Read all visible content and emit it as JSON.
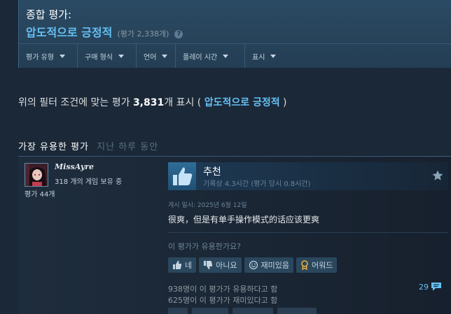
{
  "summary": {
    "label": "종합 평가:",
    "value": "압도적으로 긍정적",
    "count": "(평가 2,338개)",
    "help": "?"
  },
  "filters": [
    {
      "label": "평가 유형"
    },
    {
      "label": "구매 형식"
    },
    {
      "label": "언어"
    },
    {
      "label": "플레이 시간"
    },
    {
      "label": "표시"
    }
  ],
  "filter_result": {
    "prefix": "위의 필터 조건에 맞는 평가 ",
    "count": "3,831",
    "suffix": "개 표시 ( ",
    "rating": "압도적으로 긍정적",
    "close": " )"
  },
  "section": {
    "title": "가장 유용한 평가",
    "subtitle": "지난 하루 동안"
  },
  "review": {
    "author": {
      "name": "MissAyre",
      "games": "318 개의 게임 보유 중",
      "reviews": "평가 44개"
    },
    "recommendation": "추천",
    "hours": "기록상 4.3시간 (평가 당시 0.8시간)",
    "posted": "게시 일시: 2025년 6월 12일",
    "text": "很爽，但是有单手操作模式的话应该更爽",
    "helpful_question": "이 평가가 유용한가요?",
    "buttons": {
      "yes": "네",
      "no": "아니요",
      "funny": "재미있음",
      "award": "어워드"
    },
    "helpful_stat": "938명이 이 평가가 유용하다고 함",
    "funny_stat": "625명이 이 평가가 재미있다고 함",
    "comments": "29"
  },
  "colors": {
    "background": "#1b2838",
    "accent": "#66c0f4",
    "panel": "#2a475e"
  }
}
